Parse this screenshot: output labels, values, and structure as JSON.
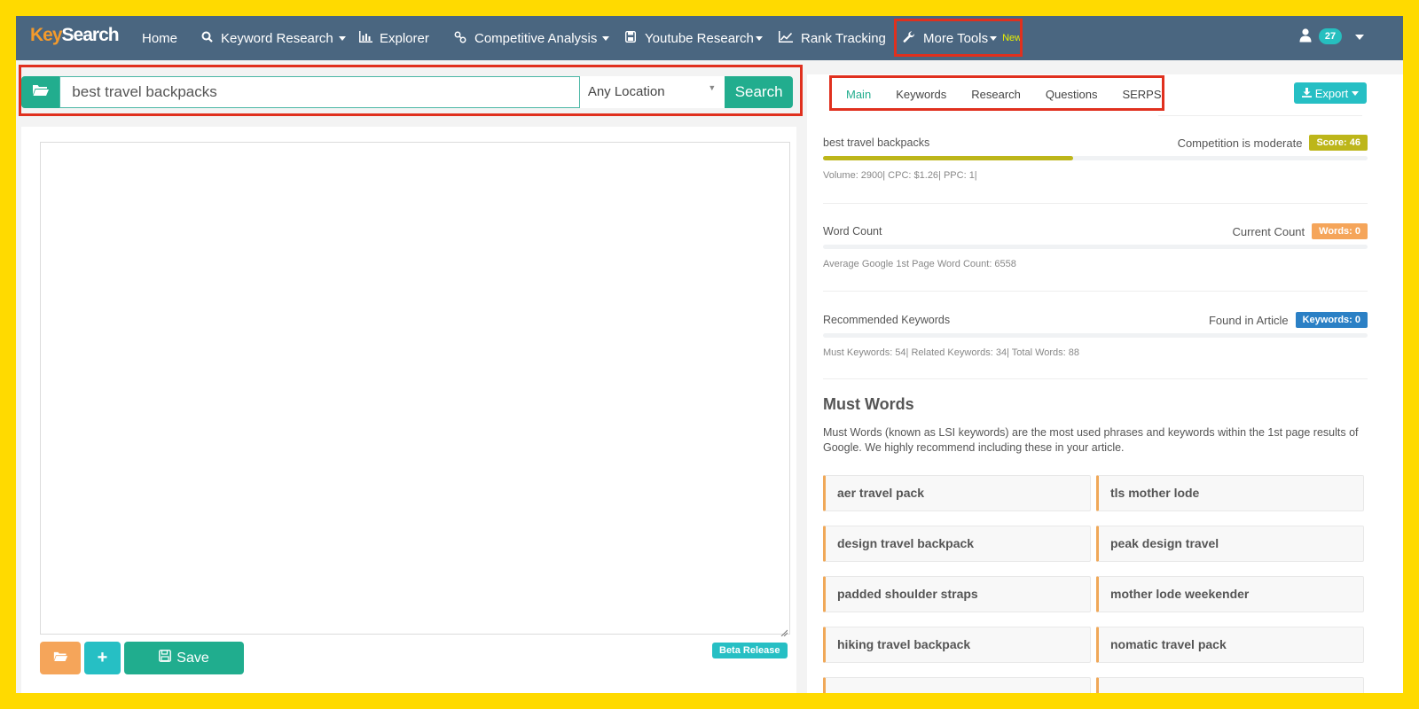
{
  "nav": {
    "logo": {
      "part1": "Key",
      "part2": "Searc",
      "part3": "h"
    },
    "items": [
      {
        "label": "Home",
        "icon": "",
        "has_caret": false
      },
      {
        "label": "Keyword Research",
        "icon": "search-icon",
        "has_caret": true
      },
      {
        "label": "Explorer",
        "icon": "bar-chart-icon",
        "has_caret": false
      },
      {
        "label": "Competitive Analysis",
        "icon": "link-icon",
        "has_caret": true
      },
      {
        "label": "Youtube Research",
        "icon": "save-icon",
        "has_caret": true
      },
      {
        "label": "Rank Tracking",
        "icon": "line-chart-icon",
        "has_caret": false
      },
      {
        "label": "More Tools",
        "icon": "wrench-icon",
        "has_caret": true,
        "badge": "New"
      }
    ],
    "notification_count": "27"
  },
  "search": {
    "query": "best travel backpacks",
    "location": "Any Location",
    "button_label": "Search"
  },
  "editor": {
    "content": "",
    "save_label": "Save",
    "add_label": "+",
    "beta_label": "Beta Release"
  },
  "right": {
    "tabs": [
      "Main",
      "Keywords",
      "Research",
      "Questions",
      "SERPS"
    ],
    "active_tab": "Main",
    "export_label": "Export",
    "competition": {
      "keyword": "best travel backpacks",
      "label": "Competition is moderate",
      "score_label": "Score: 46",
      "score": 46,
      "details": "Volume: 2900| CPC: $1.26| PPC: 1|"
    },
    "word_count": {
      "title": "Word Count",
      "label": "Current Count",
      "badge": "Words: 0",
      "details": "Average Google 1st Page Word Count: 6558"
    },
    "recommended": {
      "title": "Recommended Keywords",
      "label": "Found in Article",
      "badge": "Keywords: 0",
      "details": "Must Keywords: 54| Related Keywords: 34| Total Words: 88"
    },
    "must_words": {
      "title": "Must Words",
      "description": "Must Words (known as LSI keywords) are the most used phrases and keywords within the 1st page results of Google. We highly recommend including these in your article.",
      "keywords": [
        "aer travel pack",
        "tls mother lode",
        "design travel backpack",
        "peak design travel",
        "padded shoulder straps",
        "mother lode weekender",
        "hiking travel backpack",
        "nomatic travel pack",
        "",
        ""
      ]
    }
  },
  "colors": {
    "nav_bg": "#4a6680",
    "accent_green": "#22ad8e",
    "accent_teal": "#26bfc4",
    "score": "#bdb61a",
    "words_badge": "#f5a55a",
    "keywords_badge": "#2b80c5",
    "highlight_red": "#e0301e",
    "frame_yellow": "#FFDA00"
  }
}
